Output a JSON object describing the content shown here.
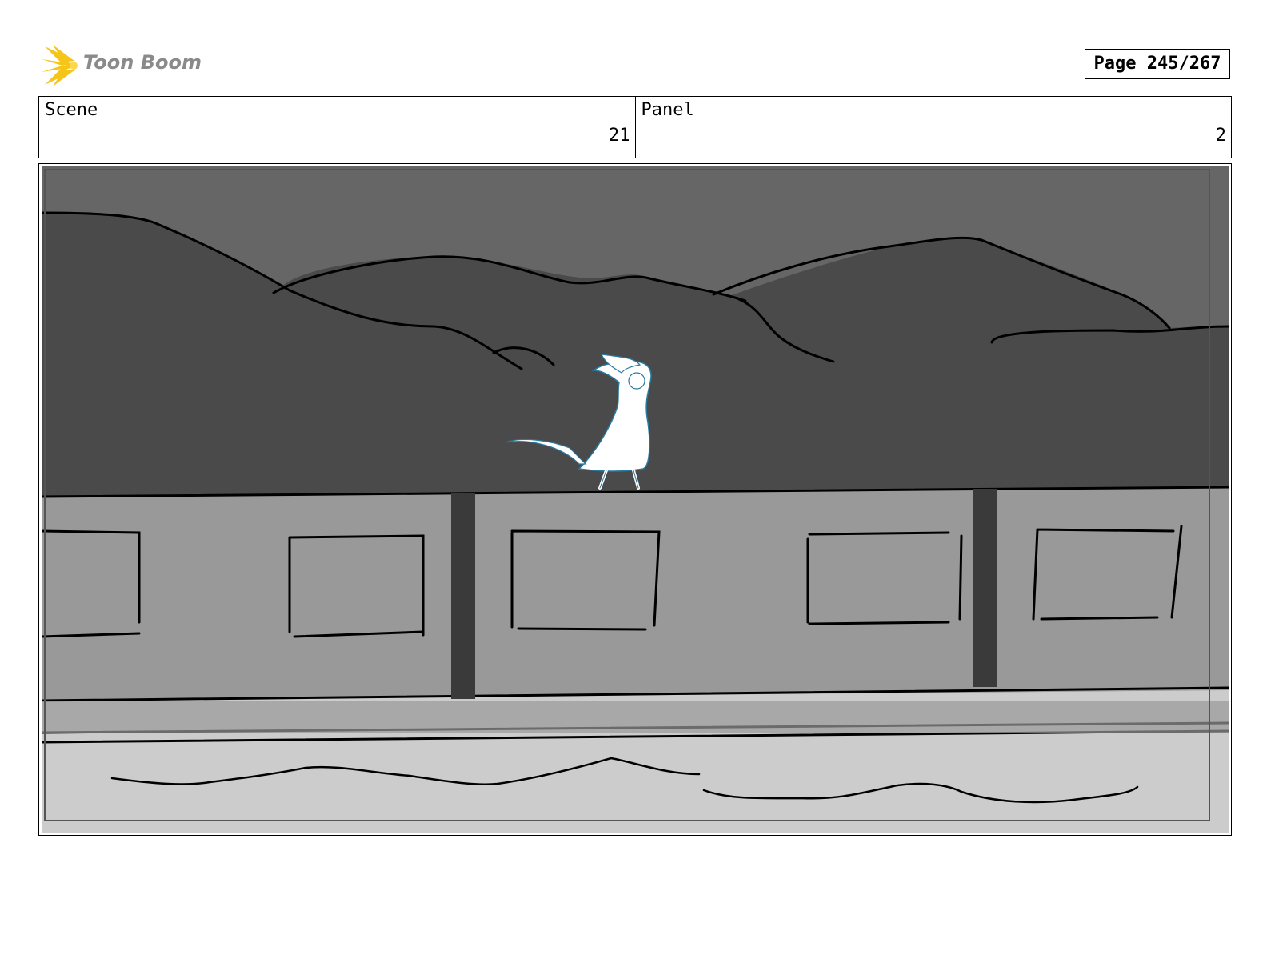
{
  "header": {
    "logo_text": "Toon Boom",
    "page_label": "Page 245/267"
  },
  "info": {
    "scene_label": "Scene",
    "scene_value": "21",
    "panel_label": "Panel",
    "panel_value": "2"
  },
  "colors": {
    "sky": "#666666",
    "mountains": "#4a4a4a",
    "wall": "#999999",
    "ground": "#cccccc",
    "logo_accent": "#f5c518"
  }
}
